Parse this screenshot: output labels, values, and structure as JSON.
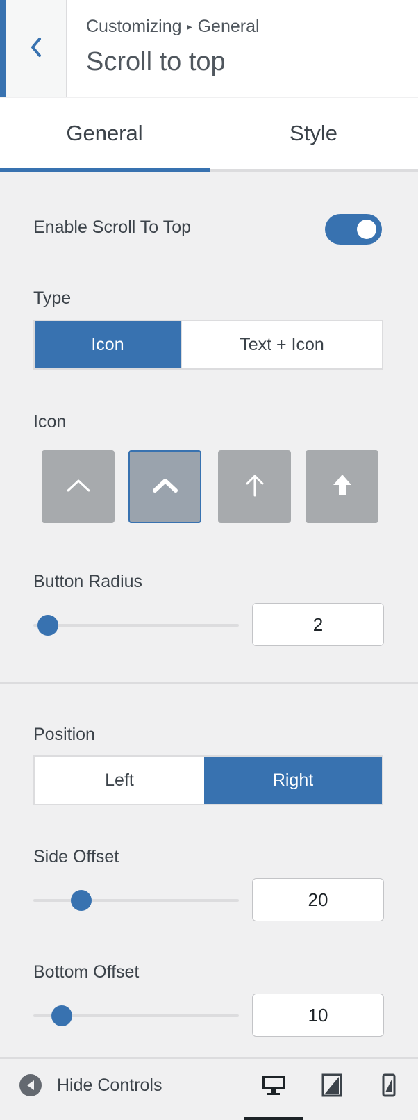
{
  "header": {
    "breadcrumb": [
      "Customizing",
      "General"
    ],
    "title": "Scroll to top"
  },
  "tabs": [
    {
      "label": "General",
      "active": true
    },
    {
      "label": "Style",
      "active": false
    }
  ],
  "settings": {
    "enable": {
      "label": "Enable Scroll To Top",
      "value": true
    },
    "type": {
      "label": "Type",
      "options": [
        "Icon",
        "Text + Icon"
      ],
      "selected": "Icon"
    },
    "icon": {
      "label": "Icon",
      "options": [
        "chevron-up-icon",
        "chevron-up-bold-icon",
        "arrow-up-icon",
        "arrow-up-bold-icon"
      ],
      "selected_index": 1
    },
    "button_radius": {
      "label": "Button Radius",
      "value": "2",
      "slider_fraction": 0.02
    },
    "position": {
      "label": "Position",
      "options": [
        "Left",
        "Right"
      ],
      "selected": "Right"
    },
    "side_offset": {
      "label": "Side Offset",
      "value": "20",
      "slider_fraction": 0.2
    },
    "bottom_offset": {
      "label": "Bottom Offset",
      "value": "10",
      "slider_fraction": 0.1
    }
  },
  "footer": {
    "hide_controls_label": "Hide Controls",
    "devices": [
      "desktop-icon",
      "tablet-icon",
      "mobile-icon"
    ],
    "active_device": "desktop"
  },
  "colors": {
    "accent": "#3872b0",
    "icon_option_bg": "#a7aaad"
  }
}
